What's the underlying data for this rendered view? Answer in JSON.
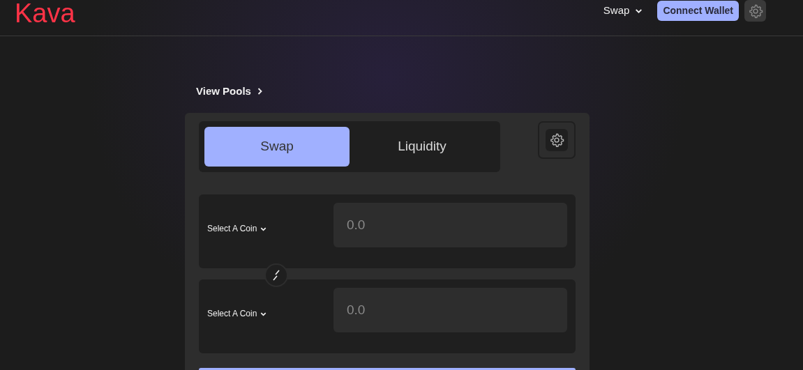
{
  "header": {
    "logo": "Kava",
    "nav_menu": "Swap",
    "connect_button": "Connect Wallet"
  },
  "view_pools_link": "View Pools",
  "tabs": [
    {
      "label": "Swap",
      "selected": true
    },
    {
      "label": "Liquidity",
      "selected": false
    }
  ],
  "coin_panels": [
    {
      "selector": "Select A Coin",
      "placeholder": "0.0"
    },
    {
      "selector": "Select A Coin",
      "placeholder": "0.0"
    }
  ]
}
